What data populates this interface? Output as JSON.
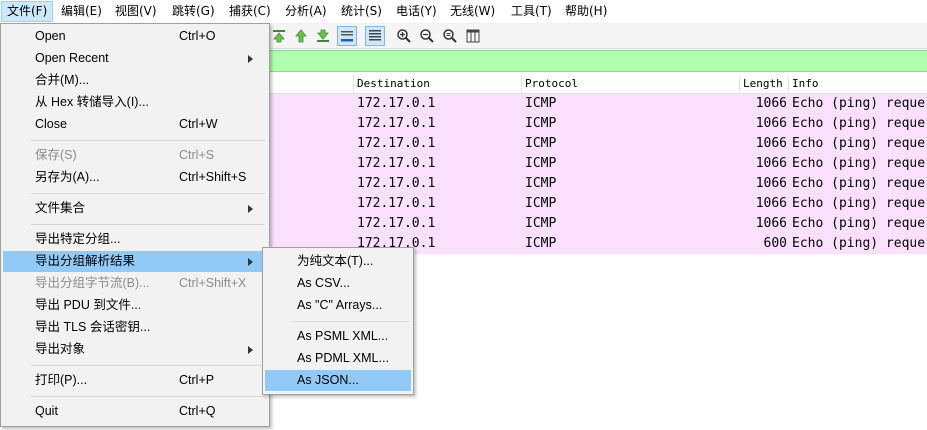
{
  "menubar": [
    {
      "label": "文件(F)",
      "active": true
    },
    {
      "label": "编辑(E)"
    },
    {
      "label": "视图(V)"
    },
    {
      "label": "跳转(G)"
    },
    {
      "label": "捕获(C)"
    },
    {
      "label": "分析(A)"
    },
    {
      "label": "统计(S)"
    },
    {
      "label": "电话(Y)"
    },
    {
      "label": "无线(W)"
    },
    {
      "label": "工具(T)"
    },
    {
      "label": "帮助(H)"
    }
  ],
  "columns": {
    "destination": "Destination",
    "protocol": "Protocol",
    "length": "Length",
    "info": "Info"
  },
  "rows": [
    {
      "destination": "172.17.0.1",
      "protocol": "ICMP",
      "length": "1066",
      "info": "Echo (ping) reque"
    },
    {
      "destination": "172.17.0.1",
      "protocol": "ICMP",
      "length": "1066",
      "info": "Echo (ping) reque"
    },
    {
      "destination": "172.17.0.1",
      "protocol": "ICMP",
      "length": "1066",
      "info": "Echo (ping) reque"
    },
    {
      "destination": "172.17.0.1",
      "protocol": "ICMP",
      "length": "1066",
      "info": "Echo (ping) reque"
    },
    {
      "destination": "172.17.0.1",
      "protocol": "ICMP",
      "length": "1066",
      "info": "Echo (ping) reque"
    },
    {
      "destination": "172.17.0.1",
      "protocol": "ICMP",
      "length": "1066",
      "info": "Echo (ping) reque"
    },
    {
      "destination": "172.17.0.1",
      "protocol": "ICMP",
      "length": "1066",
      "info": "Echo (ping) reque"
    },
    {
      "destination": "172.17.0.1",
      "protocol": "ICMP",
      "length": "600",
      "info": "Echo (ping) reque"
    }
  ],
  "file_menu": {
    "open": {
      "label": "Open",
      "shortcut": "Ctrl+O"
    },
    "open_recent": {
      "label": "Open Recent"
    },
    "merge": {
      "label": "合并(M)..."
    },
    "import_hex": {
      "label": "从 Hex 转储导入(I)..."
    },
    "close": {
      "label": "Close",
      "shortcut": "Ctrl+W"
    },
    "save": {
      "label": "保存(S)",
      "shortcut": "Ctrl+S"
    },
    "save_as": {
      "label": "另存为(A)...",
      "shortcut": "Ctrl+Shift+S"
    },
    "file_set": {
      "label": "文件集合"
    },
    "export_specified": {
      "label": "导出特定分组..."
    },
    "export_dissections": {
      "label": "导出分组解析结果"
    },
    "export_bytes": {
      "label": "导出分组字节流(B)...",
      "shortcut": "Ctrl+Shift+X"
    },
    "export_pdu": {
      "label": "导出 PDU 到文件..."
    },
    "export_tls": {
      "label": "导出 TLS 会话密钥..."
    },
    "export_objects": {
      "label": "导出对象"
    },
    "print": {
      "label": "打印(P)...",
      "shortcut": "Ctrl+P"
    },
    "quit": {
      "label": "Quit",
      "shortcut": "Ctrl+Q"
    }
  },
  "export_submenu": {
    "plain_text": "为纯文本(T)...",
    "csv": "As CSV...",
    "c_arrays": "As \"C\" Arrays...",
    "psml": "As PSML XML...",
    "pdml": "As PDML XML...",
    "json": "As JSON..."
  },
  "toolbar_icons": [
    "first-packet-icon",
    "last-packet-icon",
    "autoscroll-icon",
    "colorize-icon",
    "zoom-in-icon",
    "zoom-out-icon",
    "zoom-normal-icon",
    "resize-columns-icon"
  ],
  "colors": {
    "row_bg": "#fce0ff",
    "filter_bg": "#afffaf",
    "menu_highlight": "#91c9f7"
  }
}
